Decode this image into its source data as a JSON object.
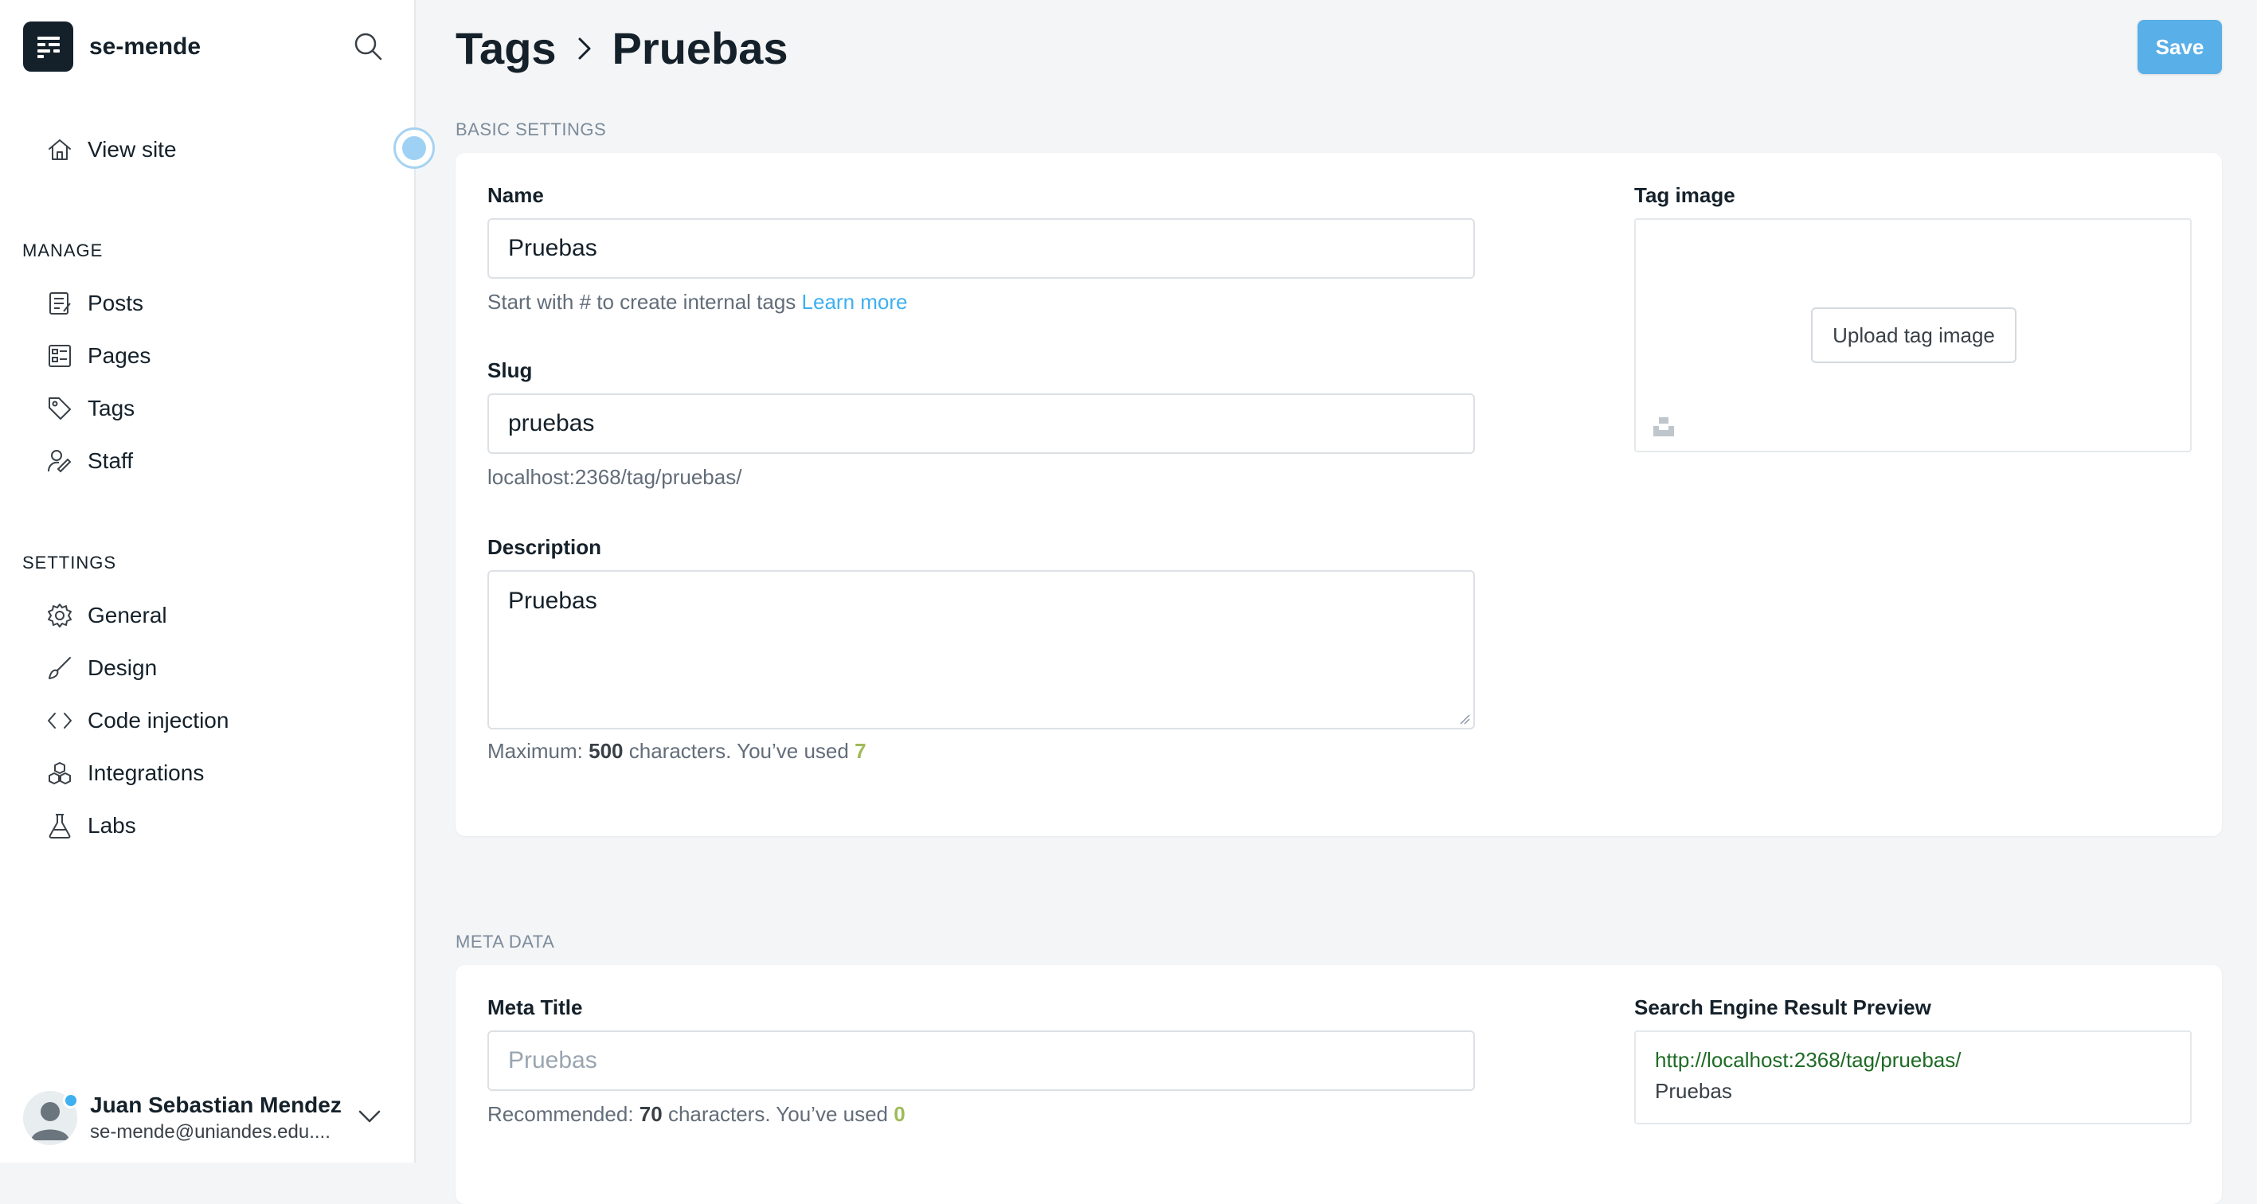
{
  "brand": {
    "name": "se-mende"
  },
  "sidebar": {
    "view_site": "View site",
    "manage_title": "MANAGE",
    "manage_items": [
      {
        "label": "Posts",
        "icon": "posts-icon"
      },
      {
        "label": "Pages",
        "icon": "pages-icon"
      },
      {
        "label": "Tags",
        "icon": "tag-icon"
      },
      {
        "label": "Staff",
        "icon": "staff-icon"
      }
    ],
    "settings_title": "SETTINGS",
    "settings_items": [
      {
        "label": "General",
        "icon": "gear-icon"
      },
      {
        "label": "Design",
        "icon": "brush-icon"
      },
      {
        "label": "Code injection",
        "icon": "code-icon"
      },
      {
        "label": "Integrations",
        "icon": "integrations-icon"
      },
      {
        "label": "Labs",
        "icon": "flask-icon"
      }
    ]
  },
  "user": {
    "name": "Juan Sebastian Mendez",
    "email": "se-mende@uniandes.edu...."
  },
  "header": {
    "breadcrumb_parent": "Tags",
    "breadcrumb_current": "Pruebas",
    "save_label": "Save"
  },
  "basic": {
    "section_label": "BASIC SETTINGS",
    "name_label": "Name",
    "name_value": "Pruebas",
    "name_hint": "Start with # to create internal tags",
    "learn_more": "Learn more",
    "slug_label": "Slug",
    "slug_value": "pruebas",
    "slug_hint": "localhost:2368/tag/pruebas/",
    "description_label": "Description",
    "description_value": "Pruebas",
    "desc_hint_prefix": "Maximum:",
    "desc_max": "500",
    "desc_hint_mid": "characters. You’ve used",
    "desc_used": "7",
    "tag_image_label": "Tag image",
    "upload_label": "Upload tag image"
  },
  "meta": {
    "section_label": "META DATA",
    "meta_title_label": "Meta Title",
    "meta_title_placeholder": "Pruebas",
    "meta_hint_prefix": "Recommended:",
    "meta_recommended": "70",
    "meta_hint_mid": "characters. You’ve used",
    "meta_used": "0",
    "serp_label": "Search Engine Result Preview",
    "serp_url": "http://localhost:2368/tag/pruebas/",
    "serp_title": "Pruebas"
  },
  "colors": {
    "accent": "#59afe8",
    "link": "#3eb0ef",
    "counter_green": "#9fbb58",
    "serp_url": "#1e6b25"
  }
}
